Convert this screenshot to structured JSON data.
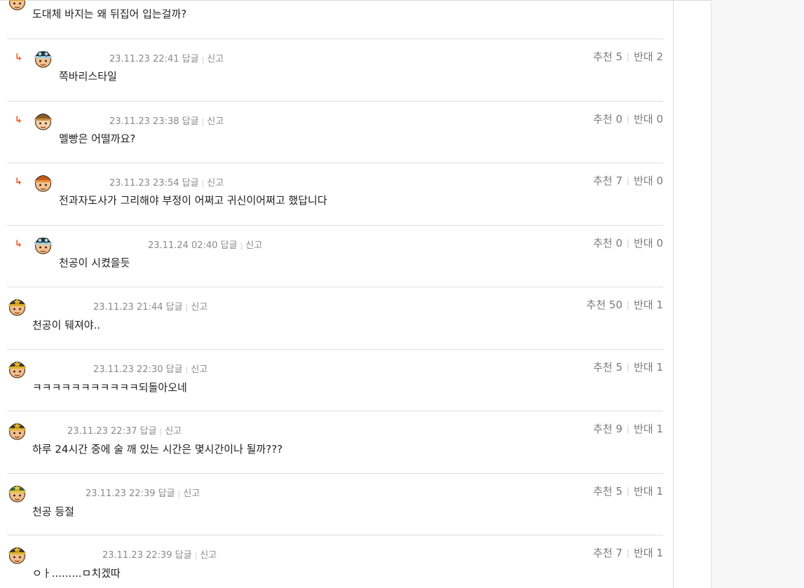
{
  "colors": {
    "reply_arrow": "#e8561e",
    "meta_text": "#8a8a8a",
    "divider": "#dedede"
  },
  "reply_glyph": "↳",
  "comments": [
    {
      "type": "first",
      "avatar": "helmet",
      "body": "도대체 바지는 왜 뒤집어 입는걸까?"
    },
    {
      "type": "reply",
      "avatar": "goggles",
      "date": "23.11.23 22:41",
      "reply_label": "답글",
      "report_label": "신고",
      "like_label": "추천",
      "likes": "5",
      "dislike_label": "반대",
      "dislikes": "2",
      "body": "쪽바리스타일"
    },
    {
      "type": "reply",
      "avatar": "pigtails",
      "date": "23.11.23 23:38",
      "reply_label": "답글",
      "report_label": "신고",
      "like_label": "추천",
      "likes": "0",
      "dislike_label": "반대",
      "dislikes": "0",
      "body": "멜빵은 어떨까요?"
    },
    {
      "type": "reply",
      "avatar": "orange",
      "date": "23.11.23 23:54",
      "reply_label": "답글",
      "report_label": "신고",
      "like_label": "추천",
      "likes": "7",
      "dislike_label": "반대",
      "dislikes": "0",
      "body": "전과자도사가 그리해야 부정이 어쩌고 귀신이어쩌고 했답니다"
    },
    {
      "type": "reply",
      "avatar": "goggles",
      "date": "23.11.24 02:40",
      "reply_label": "답글",
      "report_label": "신고",
      "like_label": "추천",
      "likes": "0",
      "dislike_label": "반대",
      "dislikes": "0",
      "body": "천공이 시켰을듯"
    },
    {
      "type": "top",
      "avatar": "star",
      "date": "23.11.23 21:44",
      "reply_label": "답글",
      "report_label": "신고",
      "like_label": "추천",
      "likes": "50",
      "dislike_label": "반대",
      "dislikes": "1",
      "body": "천공이 뒈져야.."
    },
    {
      "type": "top",
      "avatar": "star",
      "date": "23.11.23 22:30",
      "reply_label": "답글",
      "report_label": "신고",
      "like_label": "추천",
      "likes": "5",
      "dislike_label": "반대",
      "dislikes": "1",
      "body": "ㅋㅋㅋㅋㅋㅋㅋㅋㅋㅋㅋ되돌아오네"
    },
    {
      "type": "top",
      "avatar": "star",
      "date": "23.11.23 22:37",
      "reply_label": "답글",
      "report_label": "신고",
      "like_label": "추천",
      "likes": "9",
      "dislike_label": "반대",
      "dislikes": "1",
      "body": "하루 24시간 중에 술 깨 있는 시간은 몇시간이나 될까???"
    },
    {
      "type": "top",
      "avatar": "soldier",
      "date": "23.11.23 22:39",
      "reply_label": "답글",
      "report_label": "신고",
      "like_label": "추천",
      "likes": "5",
      "dislike_label": "반대",
      "dislikes": "1",
      "body": "천공 등절"
    },
    {
      "type": "top",
      "avatar": "star",
      "date": "23.11.23 22:39",
      "reply_label": "답글",
      "report_label": "신고",
      "like_label": "추천",
      "likes": "7",
      "dislike_label": "반대",
      "dislikes": "1",
      "body": "ㅇㅏ.........ㅁ치겠따"
    }
  ]
}
